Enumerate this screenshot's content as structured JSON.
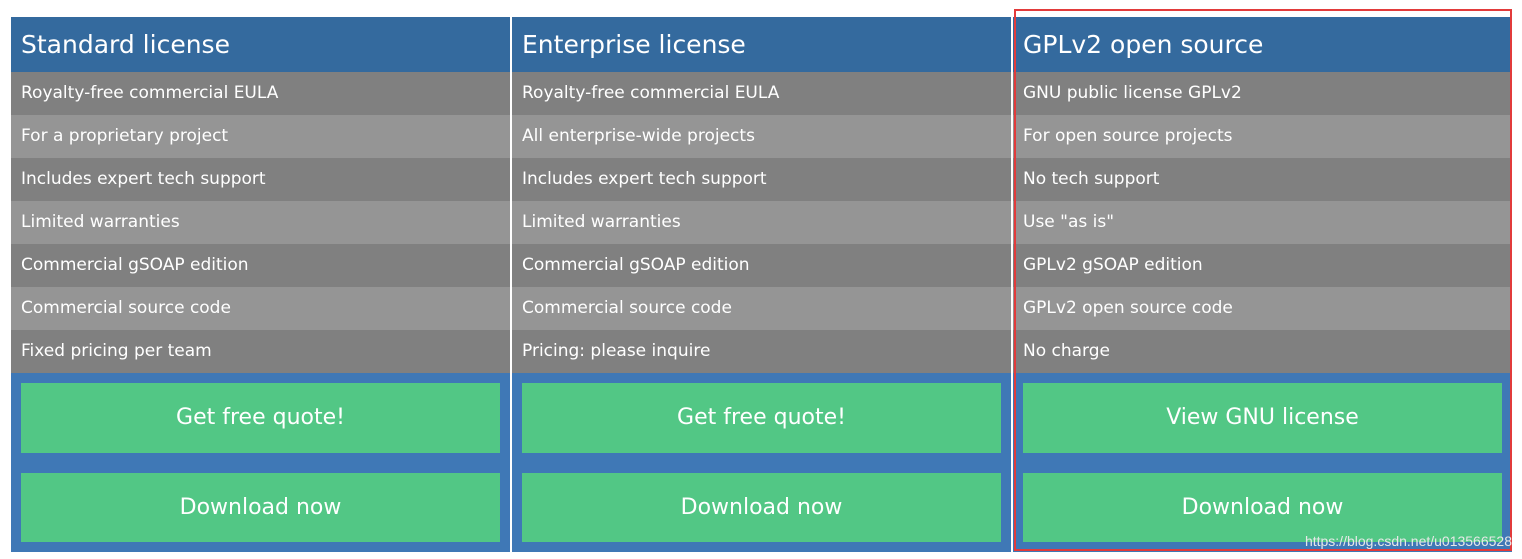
{
  "columns": [
    {
      "title": "Standard license",
      "rows": [
        "Royalty-free commercial EULA",
        "For a proprietary project",
        "Includes expert tech support",
        "Limited warranties",
        "Commercial gSOAP edition",
        "Commercial source code",
        "Fixed pricing per team"
      ],
      "primary_button": "Get free quote!",
      "download_button": "Download now"
    },
    {
      "title": "Enterprise license",
      "rows": [
        "Royalty-free commercial EULA",
        "All enterprise-wide projects",
        "Includes expert tech support",
        "Limited warranties",
        "Commercial gSOAP edition",
        "Commercial source code",
        "Pricing: please inquire"
      ],
      "primary_button": "Get free quote!",
      "download_button": "Download now"
    },
    {
      "title": "GPLv2 open source",
      "rows": [
        "GNU public license GPLv2",
        "For open source projects",
        "No tech support",
        "Use \"as is\"",
        "GPLv2 gSOAP edition",
        "GPLv2 open source code",
        "No charge"
      ],
      "primary_button": "View GNU license",
      "download_button": "Download now"
    }
  ],
  "watermark": "https://blog.csdn.net/u013566528",
  "colors": {
    "header": "#346a9e",
    "row_dark": "#808080",
    "row_light": "#959595",
    "actions_bg": "#3f78b6",
    "button": "#52c785",
    "highlight_border": "#e23b3b"
  }
}
